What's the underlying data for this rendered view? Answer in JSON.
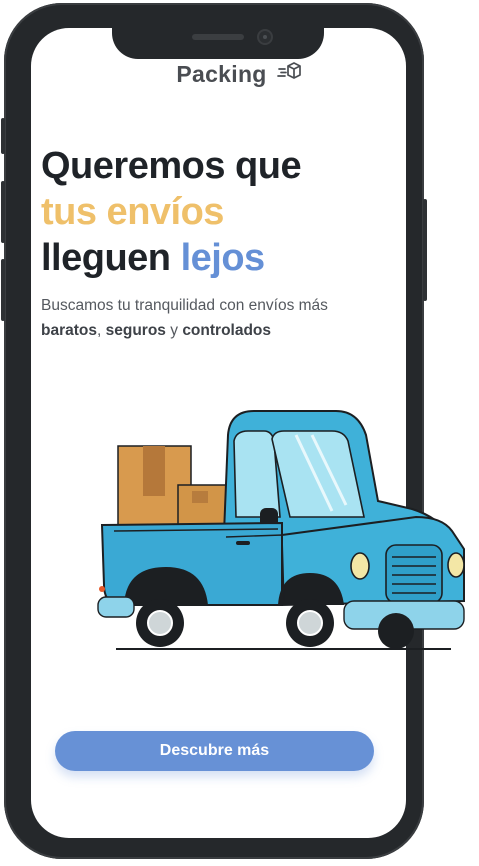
{
  "brand": {
    "name": "Packing",
    "icon": "fast-box-icon"
  },
  "hero": {
    "line1": "Queremos que",
    "line2": "tus envíos",
    "line3a": "lleguen",
    "line3b": "lejos",
    "sub_intro": "Buscamos tu tranquilidad con envíos más",
    "sub_bold1": "baratos",
    "sub_sep1": ",",
    "sub_bold2": "seguros",
    "sub_sep2": "y",
    "sub_bold3": "controlados"
  },
  "illustration": "pickup-truck-with-boxes",
  "cta": {
    "label": "Descubre más"
  },
  "colors": {
    "accent_orange": "#efc06a",
    "accent_blue": "#6590d6",
    "button": "#6791d6",
    "truck": "#3fb1d9"
  }
}
